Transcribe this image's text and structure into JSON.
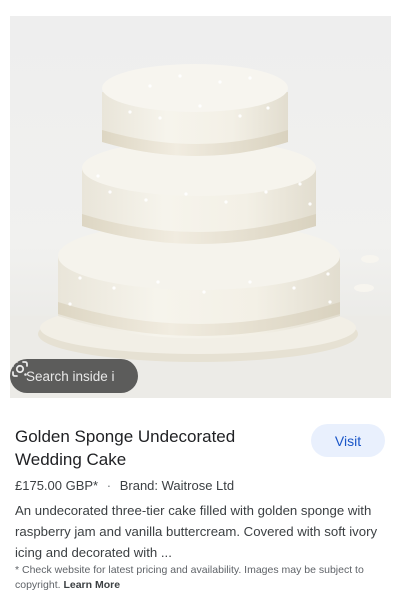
{
  "image": {
    "alt": "Golden Sponge Undecorated Wedding Cake",
    "lens_chip_label": "Search inside image",
    "lens_chip_visible_text": "Search inside i"
  },
  "product": {
    "title": "Golden Sponge Undecorated Wedding Cake",
    "visit_label": "Visit",
    "price": "£175.00 GBP*",
    "separator": "·",
    "brand": "Brand: Waitrose Ltd",
    "description": "An undecorated three-tier cake filled with golden sponge with raspberry jam and vanilla buttercream. Covered with soft ivory icing and decorated with ..."
  },
  "disclaimer": {
    "text": "* Check website for latest pricing and availability. Images may be subject to copyright.",
    "learn_more": "Learn More"
  },
  "colors": {
    "visit_bg": "#e9f0fd",
    "visit_text": "#1a56c8",
    "cake_icing": "#f4f1e8",
    "ribbon": "#ece6d6"
  },
  "icons": {
    "lens": "google-lens-icon"
  }
}
